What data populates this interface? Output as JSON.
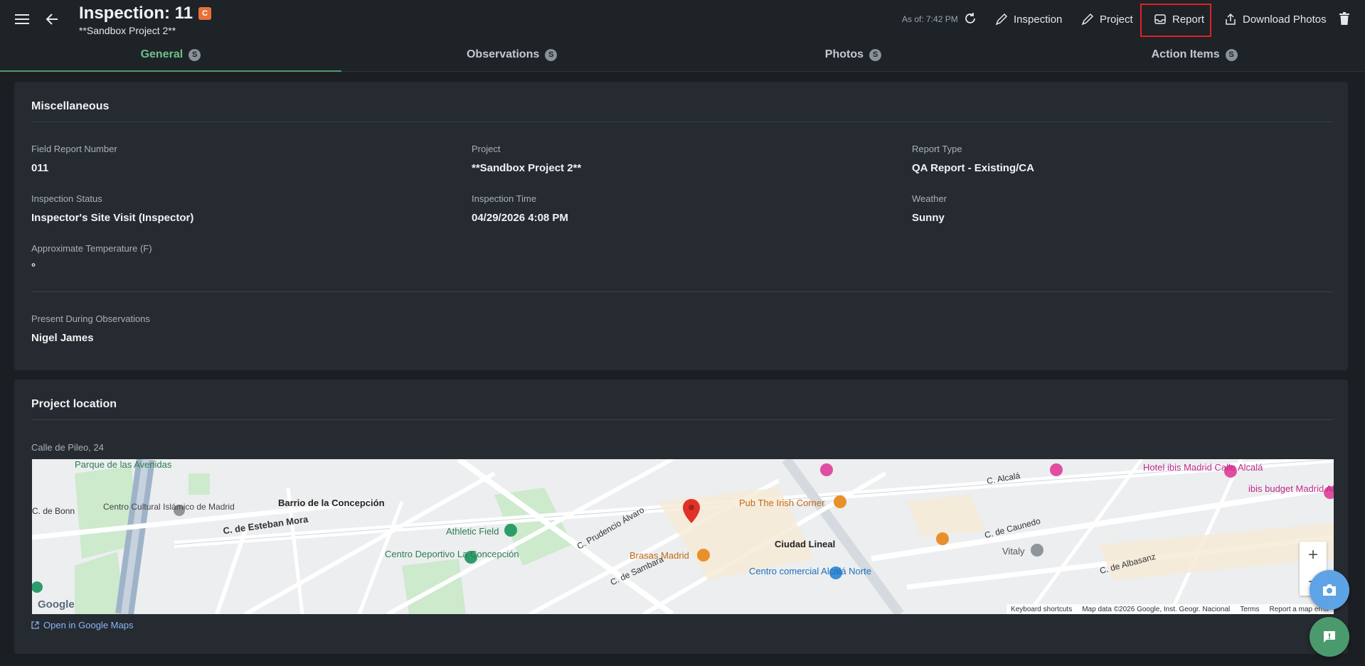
{
  "header": {
    "title": "Inspection: 11",
    "title_badge": "C",
    "subtitle": "**Sandbox Project 2**",
    "as_of": "As of: 7:42 PM",
    "actions": {
      "inspection": "Inspection",
      "project": "Project",
      "report": "Report",
      "download_photos": "Download Photos"
    }
  },
  "tabs": [
    {
      "label": "General",
      "count": "S"
    },
    {
      "label": "Observations",
      "count": "S"
    },
    {
      "label": "Photos",
      "count": "S"
    },
    {
      "label": "Action Items",
      "count": "S"
    }
  ],
  "misc": {
    "title": "Miscellaneous",
    "fields": {
      "field_report_number": {
        "label": "Field Report Number",
        "value": "011"
      },
      "project": {
        "label": "Project",
        "value": "**Sandbox Project 2**"
      },
      "report_type": {
        "label": "Report Type",
        "value": "QA Report - Existing/CA"
      },
      "inspection_status": {
        "label": "Inspection Status",
        "value": "Inspector's Site Visit (Inspector)"
      },
      "inspection_time": {
        "label": "Inspection Time",
        "value": "04/29/2026 4:08 PM"
      },
      "weather": {
        "label": "Weather",
        "value": "Sunny"
      },
      "temperature": {
        "label": "Approximate Temperature (F)",
        "value": "°"
      },
      "present": {
        "label": "Present During Observations",
        "value": "Nigel James"
      }
    }
  },
  "location": {
    "title": "Project location",
    "address": "Calle de Pileo, 24",
    "open_maps": "Open in Google Maps",
    "map_labels": {
      "parque": "Parque de las Avenidas",
      "centro_cultural": "Centro Cultural Islámico de Madrid",
      "barrio": "Barrio de la Concepción",
      "esteban": "C. de Esteban Mora",
      "athletic": "Athletic Field",
      "deportivo": "Centro Deportivo La Concepción",
      "pub": "Pub The Irish Corner",
      "brasas": "Brasas Madrid",
      "ciudad": "Ciudad Lineal",
      "alcala_norte": "Centro comercial Alcalá Norte",
      "vitaly": "Vitaly",
      "hotel": "Hotel ibis Madrid Calle Alcalá",
      "ibis_budget": "ibis budget Madrid Albasanz",
      "alcala": "C. Alcalá",
      "caunedo": "C. de Caunedo",
      "albasanz": "C. de Albasanz",
      "prudencio": "C. Prudencio Álvaro",
      "sambara": "C. de Sambara",
      "bonn": "C. de Bonn",
      "google": "Google"
    },
    "footer": {
      "shortcuts": "Keyboard shortcuts",
      "map_data": "Map data ©2026 Google, Inst. Geogr. Nacional",
      "terms": "Terms",
      "report_error": "Report a map error"
    }
  },
  "colors": {
    "accent_green": "#6fc08a",
    "highlight_red": "#e0202a",
    "fab_blue": "#5ea3e6",
    "fab_green": "#4a9a6e"
  }
}
